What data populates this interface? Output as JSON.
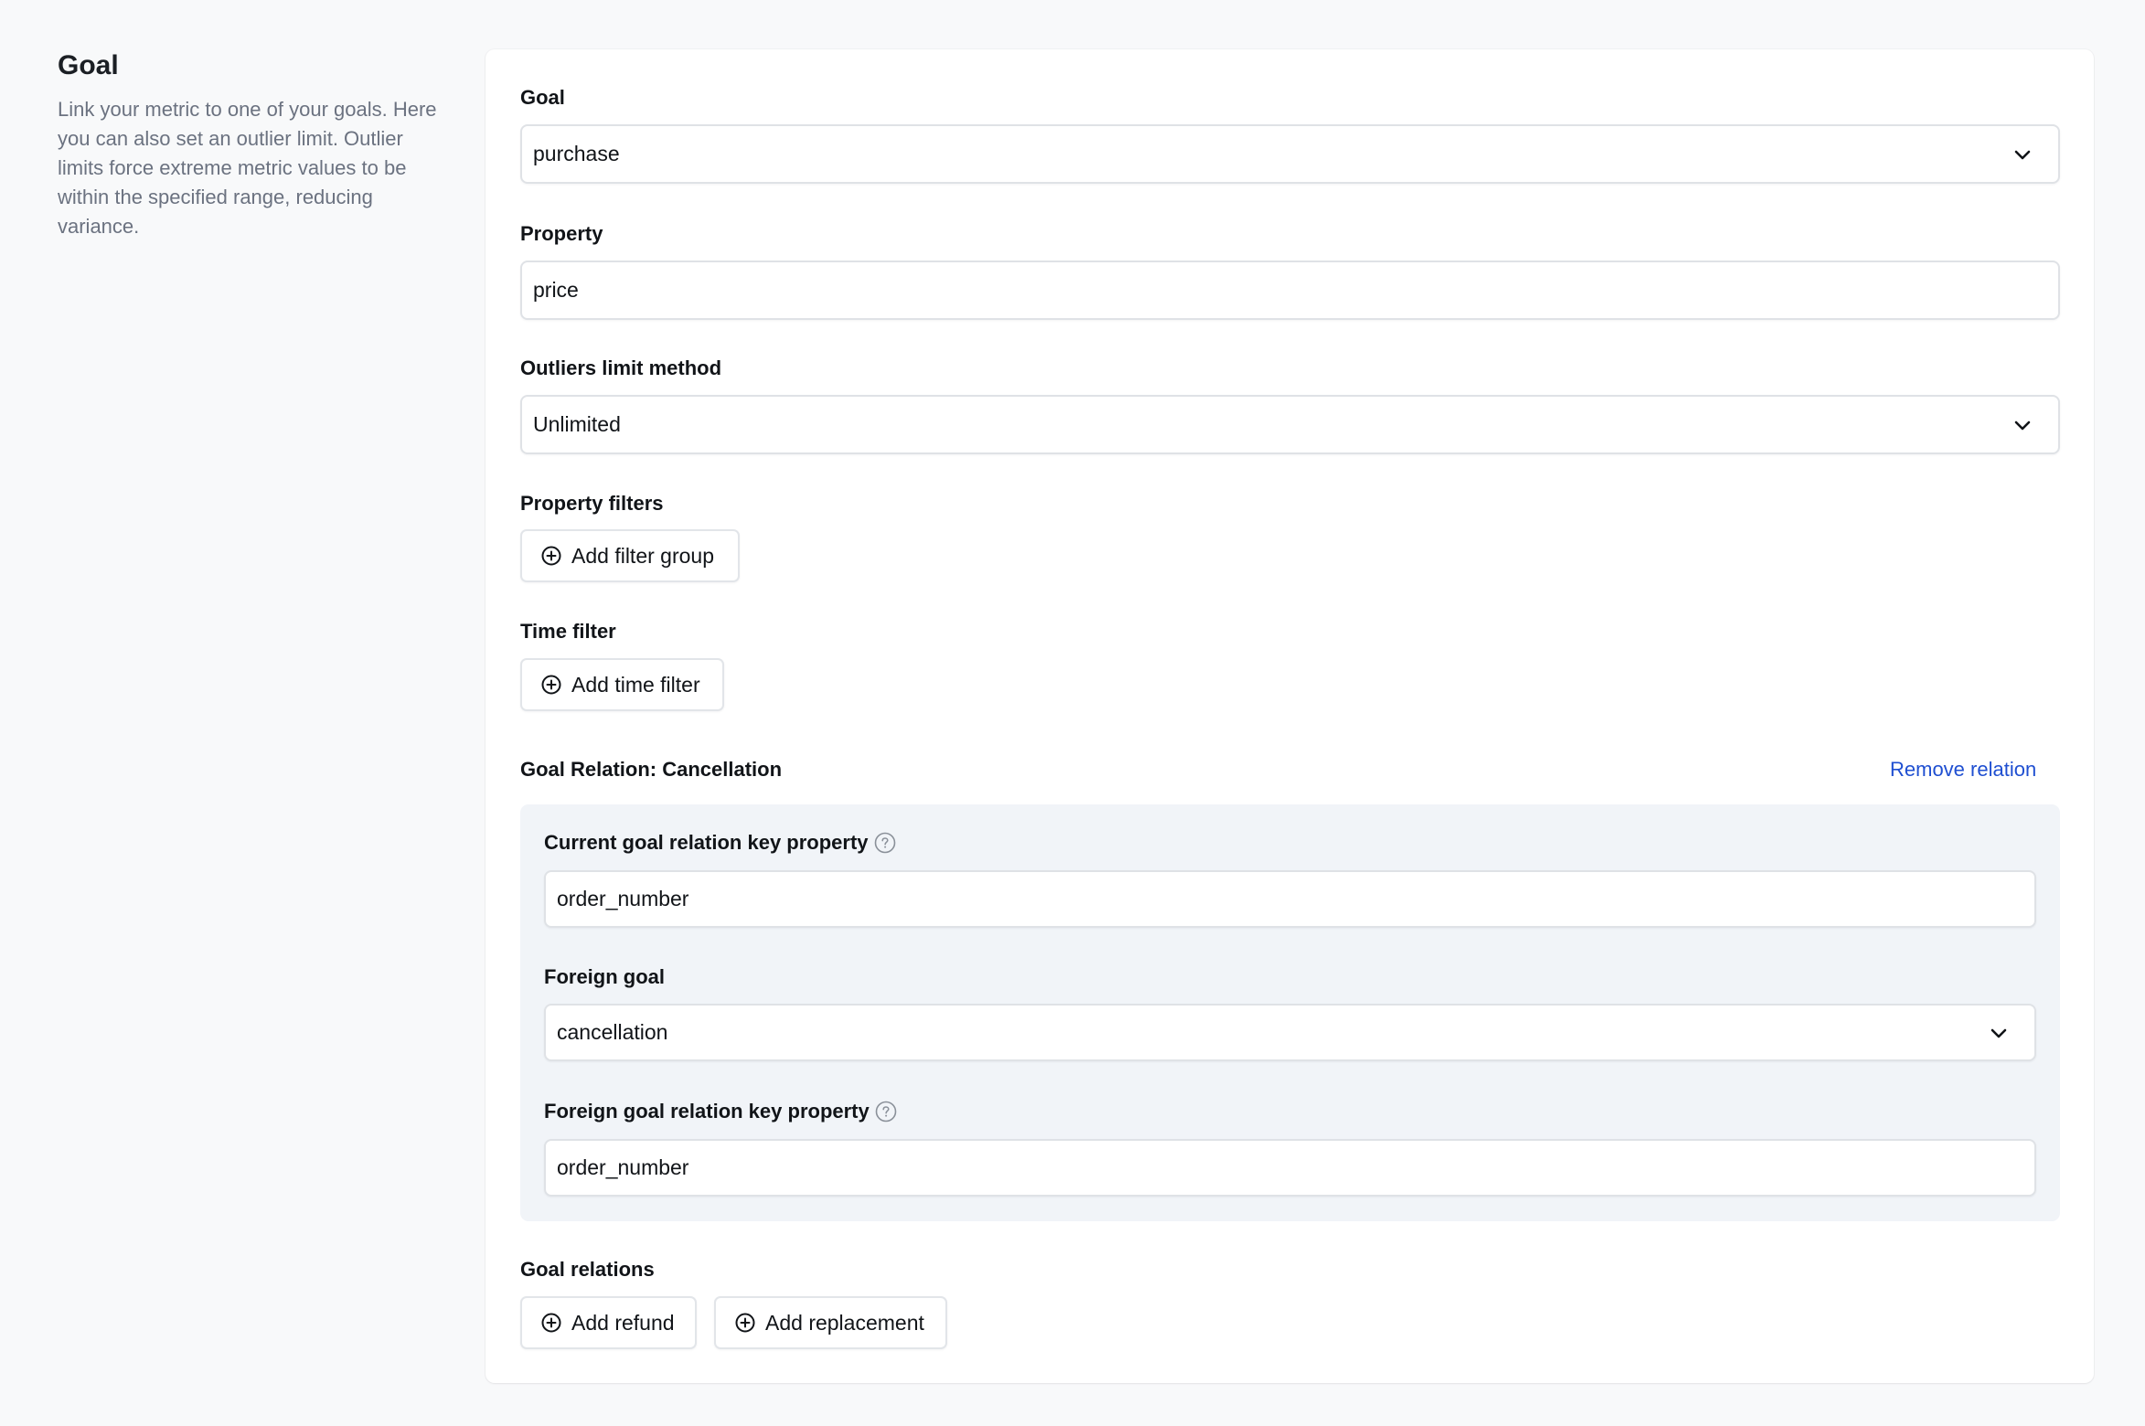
{
  "sidebar": {
    "title": "Goal",
    "description": "Link your metric to one of your goals. Here you can also set an outlier limit. Outlier limits force extreme metric values to be within the specified range, reducing variance."
  },
  "form": {
    "goal": {
      "label": "Goal",
      "value": "purchase"
    },
    "property": {
      "label": "Property",
      "value": "price"
    },
    "outliers": {
      "label": "Outliers limit method",
      "value": "Unlimited"
    },
    "property_filters": {
      "label": "Property filters",
      "button": "Add filter group"
    },
    "time_filter": {
      "label": "Time filter",
      "button": "Add time filter"
    },
    "relation": {
      "title": "Goal Relation: Cancellation",
      "remove_label": "Remove relation",
      "current_key": {
        "label": "Current goal relation key property",
        "value": "order_number"
      },
      "foreign_goal": {
        "label": "Foreign goal",
        "value": "cancellation"
      },
      "foreign_key": {
        "label": "Foreign goal relation key property",
        "value": "order_number"
      }
    },
    "goal_relations": {
      "label": "Goal relations",
      "add_refund": "Add refund",
      "add_replacement": "Add replacement"
    }
  },
  "icons": {
    "chevron": "chevron-down-icon",
    "plus": "plus-circle-icon",
    "help": "help-circle-icon"
  },
  "colors": {
    "link": "#1f4fd1",
    "panel": "#f1f4f8",
    "background": "#f8f9fa"
  }
}
